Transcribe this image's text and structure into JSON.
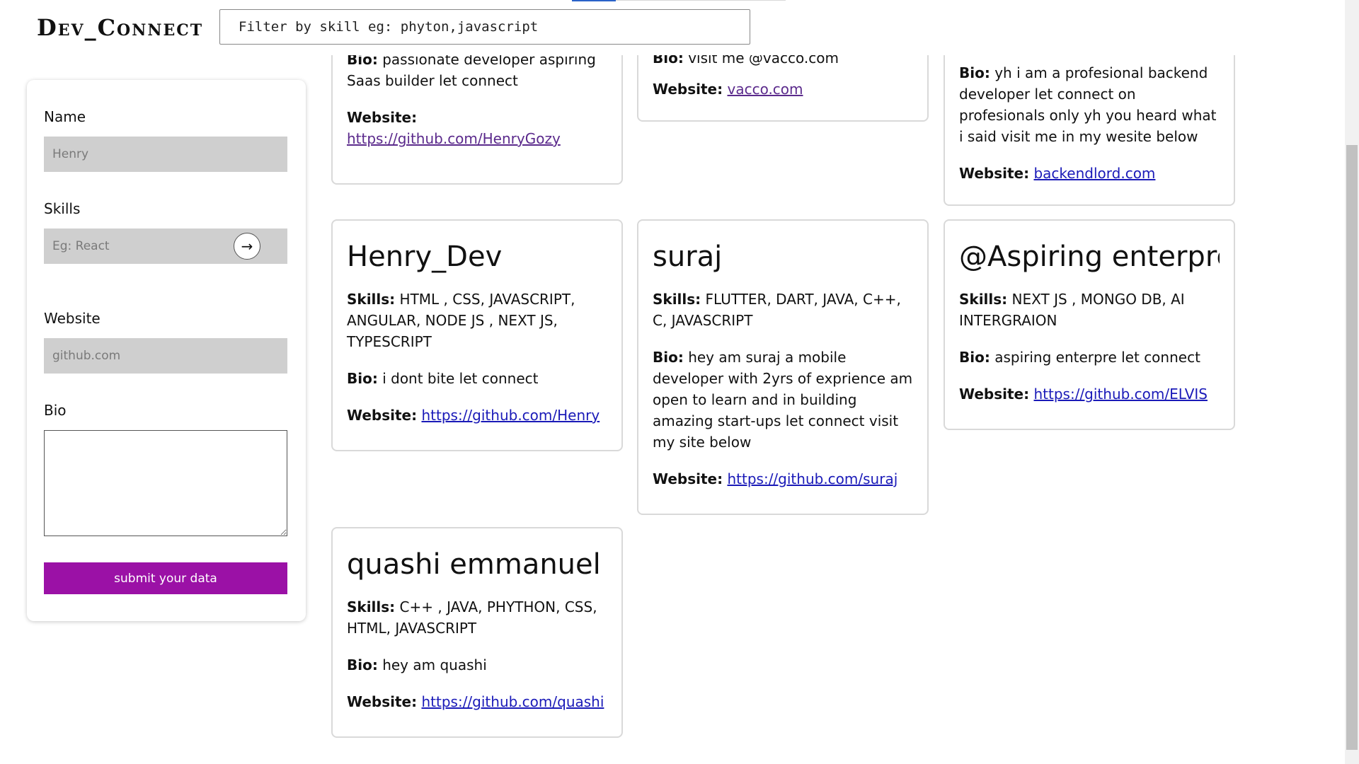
{
  "header": {
    "logo": "Dev_Connect",
    "filter_placeholder": "Filter by skill eg: phyton,javascript"
  },
  "form": {
    "name_label": "Name",
    "name_placeholder": "Henry",
    "skills_label": "Skills",
    "skills_placeholder": "Eg: React",
    "website_label": "Website",
    "website_placeholder": "github.com",
    "bio_label": "Bio",
    "submit_label": "submit your data",
    "arrow_glyph": "→"
  },
  "labels": {
    "skills": "Skills:",
    "bio": "Bio:",
    "website": "Website:"
  },
  "top_cards": [
    {
      "bio": "passionate developer aspiring Saas builder let connect",
      "website": "https://github.com/HenryGozy"
    },
    {
      "bio_partial": "visit me @vacco.com",
      "website": "vacco.com"
    },
    {
      "bio": "yh i am a profesional backend developer let connect on profesionals only yh you heard what i said visit me in my wesite below",
      "website": "backendlord.com"
    }
  ],
  "cards": [
    {
      "name": "Henry_Dev",
      "skills": "HTML , CSS, JAVASCRIPT, ANGULAR, NODE JS , NEXT JS, TYPESCRIPT",
      "bio": "i dont bite let connect",
      "website": "https://github.com/Henry"
    },
    {
      "name": "suraj",
      "skills": "FLUTTER, DART, JAVA, C++, C, JAVASCRIPT",
      "bio": "hey am suraj a mobile developer with 2yrs of exprience am open to learn and in building amazing start-ups let connect visit my site below",
      "website": "https://github.com/suraj"
    },
    {
      "name": "@Aspiring enterpre",
      "skills": "NEXT JS , MONGO DB, AI INTERGRAION",
      "bio": "aspiring enterpre let connect",
      "website": "https://github.com/ELVIS"
    },
    {
      "name": "quashi emmanuel",
      "skills": "C++ , JAVA, PHYTHON, CSS, HTML, JAVASCRIPT",
      "bio": "hey am quashi",
      "website": "https://github.com/quashi"
    }
  ]
}
